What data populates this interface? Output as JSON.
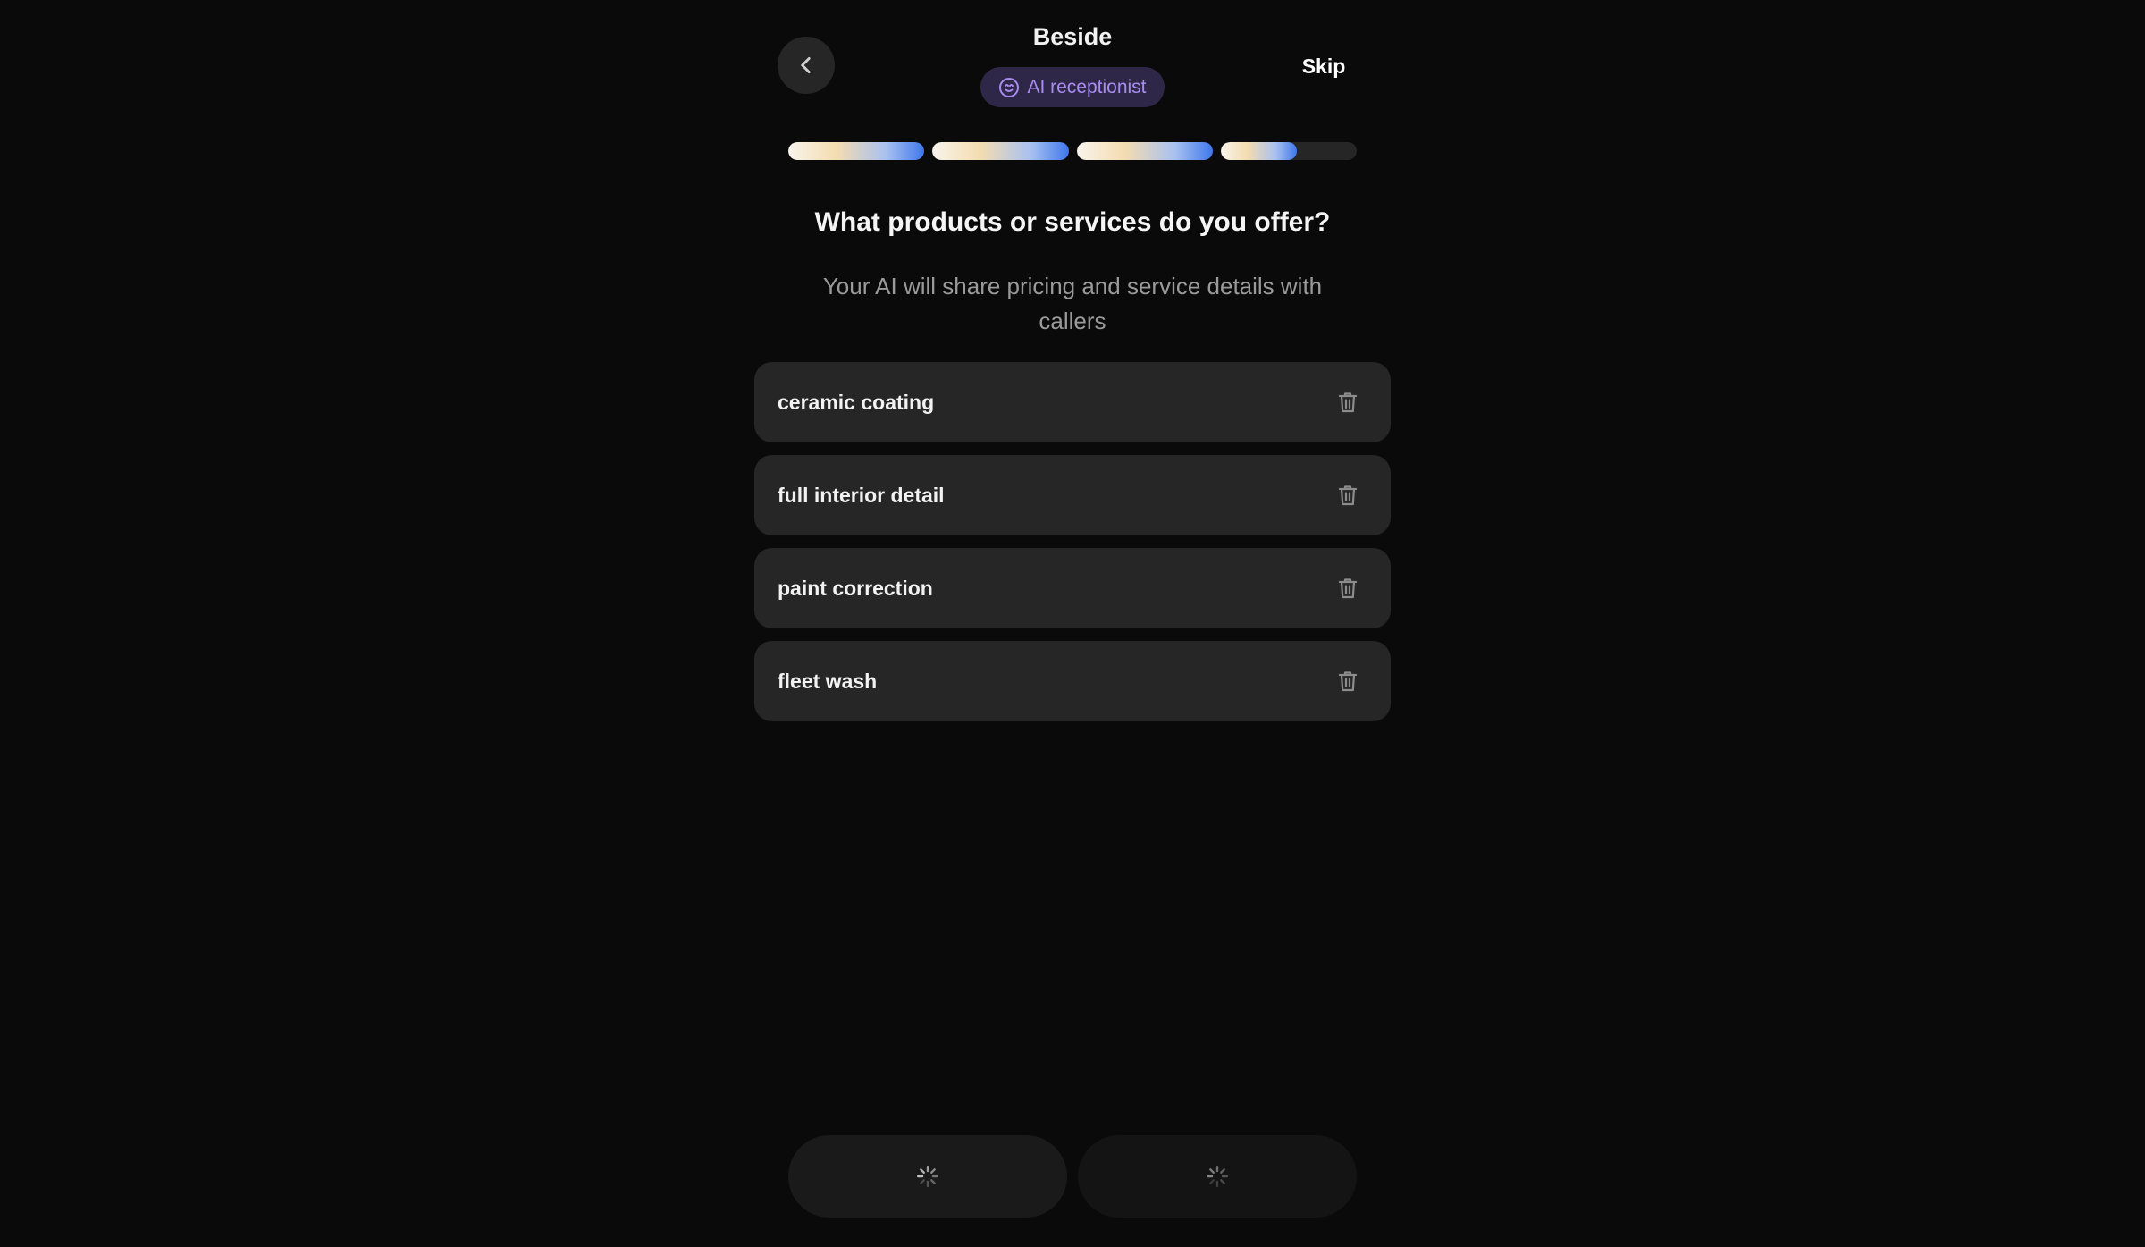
{
  "header": {
    "title": "Beside",
    "badge_label": "AI receptionist",
    "skip_label": "Skip",
    "back_icon": "chevron-left-icon",
    "badge_icon": "smiley-face-icon"
  },
  "progress": {
    "total_steps": 4,
    "segment_fill": [
      1.0,
      1.0,
      1.0,
      0.56
    ]
  },
  "question": {
    "title": "What products or services do you offer?",
    "subtitle": "Your AI will share pricing and service details with callers"
  },
  "services": {
    "items": [
      {
        "label": "ceramic coating"
      },
      {
        "label": "full interior detail"
      },
      {
        "label": "paint correction"
      },
      {
        "label": "fleet wash"
      }
    ],
    "delete_icon": "trash-icon"
  },
  "footer": {
    "left_icon": "loading-spinner-icon",
    "right_icon": "loading-spinner-icon"
  },
  "colors": {
    "background": "#0a0a0a",
    "card": "#262626",
    "badge_bg": "#2f2748",
    "badge_text": "#a98cf0",
    "accent_blue": "#3f78ec"
  }
}
